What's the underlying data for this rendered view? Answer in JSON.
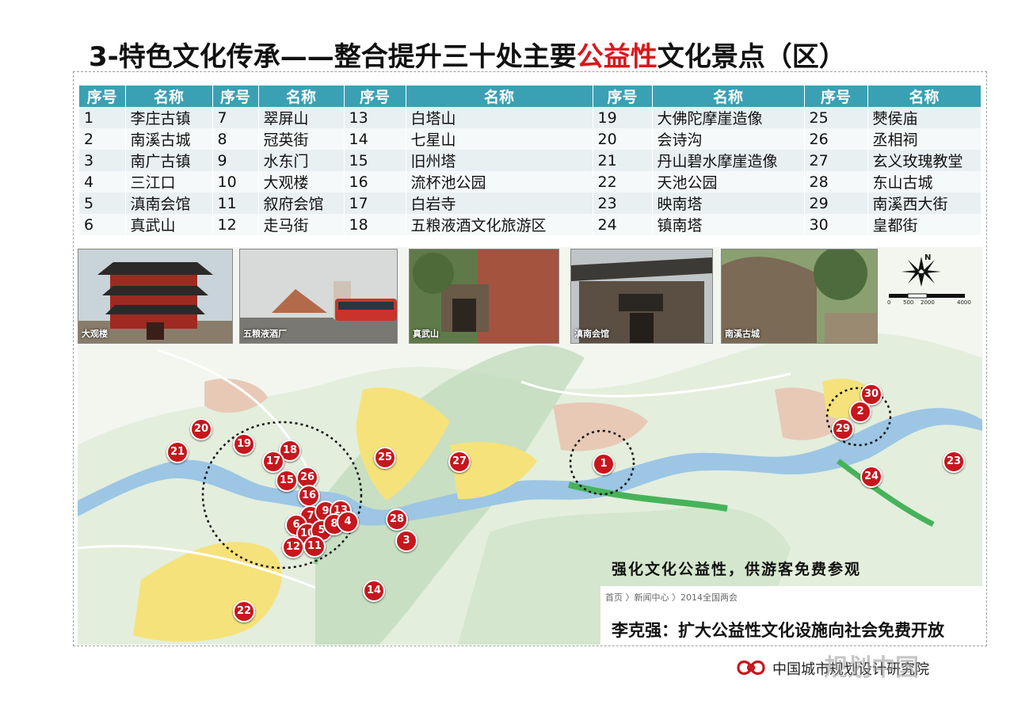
{
  "title": {
    "prefix": "3-特色文化传承——整合提升三十处主要",
    "highlight": "公益性",
    "suffix": "文化景点（区）"
  },
  "table": {
    "headers": [
      "序号",
      "名称",
      "序号",
      "名称",
      "序号",
      "名称",
      "序号",
      "名称",
      "序号",
      "名称"
    ],
    "rows": [
      [
        "1",
        "李庄古镇",
        "7",
        "翠屏山",
        "13",
        "白塔山",
        "19",
        "大佛陀摩崖造像",
        "25",
        "僰侯庙"
      ],
      [
        "2",
        "南溪古城",
        "8",
        "冠英街",
        "14",
        "七星山",
        "20",
        "会诗沟",
        "26",
        "丞相祠"
      ],
      [
        "3",
        "南广古镇",
        "9",
        "水东门",
        "15",
        "旧州塔",
        "21",
        "丹山碧水摩崖造像",
        "27",
        "玄义玫瑰教堂"
      ],
      [
        "4",
        "三江口",
        "10",
        "大观楼",
        "16",
        "流杯池公园",
        "22",
        "天池公园",
        "28",
        "东山古城"
      ],
      [
        "5",
        "滇南会馆",
        "11",
        "叙府会馆",
        "17",
        "白岩寺",
        "23",
        "映南塔",
        "29",
        "南溪西大街"
      ],
      [
        "6",
        "真武山",
        "12",
        "走马街",
        "18",
        "五粮液酒文化旅游区",
        "24",
        "镇南塔",
        "30",
        "皇都街"
      ]
    ]
  },
  "photos": [
    {
      "caption": "大观楼"
    },
    {
      "caption": "五粮液酒厂"
    },
    {
      "caption": "真武山"
    },
    {
      "caption": "滇南会馆"
    },
    {
      "caption": "南溪古城"
    }
  ],
  "scale_bar": {
    "labels": [
      "0",
      "500",
      "2000",
      "4000"
    ]
  },
  "markers": [
    "20",
    "21",
    "19",
    "18",
    "17",
    "26",
    "15",
    "16",
    "7",
    "9",
    "13",
    "6",
    "10",
    "5",
    "8",
    "4",
    "12",
    "11",
    "3",
    "28",
    "25",
    "27",
    "14",
    "22",
    "1",
    "30",
    "2",
    "29",
    "23",
    "24"
  ],
  "slogan": "强化文化公益性，供游客免费参观",
  "news": {
    "breadcrumb": "首页 〉新闻中心 〉2014全国两会",
    "headline": "李克强：扩大公益性文化设施向社会免费开放"
  },
  "footer": {
    "org": "中国城市规划设计研究院",
    "watermark": "规划中国"
  },
  "colors": {
    "header": "#3aa0b4",
    "marker": "#c8161d",
    "highlight": "#d8181c",
    "river": "#9cc6e4",
    "green": "#7fcf8a"
  }
}
